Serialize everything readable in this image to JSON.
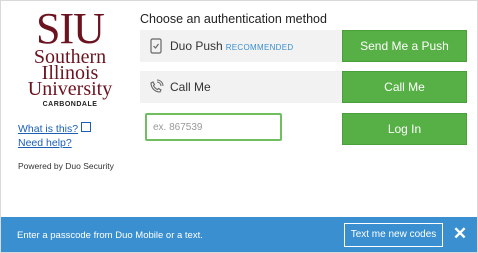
{
  "logo": {
    "abbr": "SIU",
    "name_line1": "Southern",
    "name_line2": "Illinois",
    "name_line3": "University",
    "campus": "CARBONDALE"
  },
  "links": {
    "what_is_this": "What is this?",
    "need_help": "Need help?"
  },
  "powered_by": "Powered by Duo Security",
  "heading": "Choose an authentication method",
  "methods": [
    {
      "label": "Duo Push",
      "badge": "RECOMMENDED",
      "button": "Send Me a Push",
      "icon": "phone-check-icon"
    },
    {
      "label": "Call Me",
      "button": "Call Me",
      "icon": "phone-ringing-icon"
    }
  ],
  "passcode": {
    "placeholder": "ex. 867539",
    "value": "",
    "button": "Log In"
  },
  "bottom_bar": {
    "message": "Enter a passcode from Duo Mobile or a text.",
    "text_button": "Text me new codes",
    "close": "✕"
  },
  "colors": {
    "brand_maroon": "#6b1420",
    "button_green": "#57b045",
    "link_blue": "#1a5fb4",
    "bar_blue": "#3a8fd0"
  }
}
